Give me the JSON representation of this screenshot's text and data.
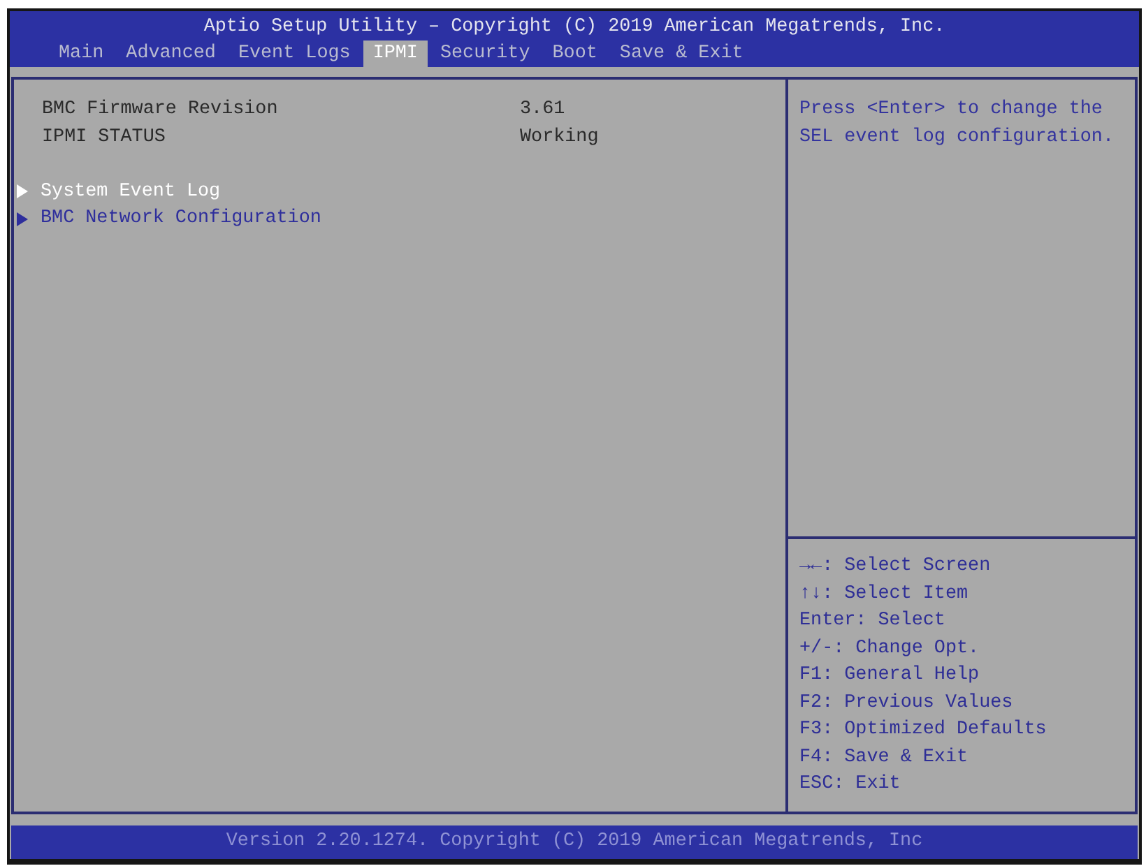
{
  "window": {
    "title": "Aptio Setup Utility – Copyright (C) 2019 American Megatrends, Inc."
  },
  "tabs": [
    {
      "label": "Main",
      "selected": false
    },
    {
      "label": "Advanced",
      "selected": false
    },
    {
      "label": "Event Logs",
      "selected": false
    },
    {
      "label": "IPMI",
      "selected": true
    },
    {
      "label": "Security",
      "selected": false
    },
    {
      "label": "Boot",
      "selected": false
    },
    {
      "label": "Save & Exit",
      "selected": false
    }
  ],
  "info_rows": [
    {
      "label": "BMC Firmware Revision",
      "value": "3.61"
    },
    {
      "label": "IPMI STATUS",
      "value": "Working"
    }
  ],
  "submenus": [
    {
      "label": "System Event Log",
      "selected": true
    },
    {
      "label": "BMC Network Configuration",
      "selected": false
    }
  ],
  "help": {
    "text": "Press <Enter> to change the SEL event log configuration."
  },
  "key_hints": [
    "→←: Select Screen",
    "↑↓: Select Item",
    "Enter: Select",
    "+/-: Change Opt.",
    "F1: General Help",
    "F2: Previous Values",
    "F3: Optimized Defaults",
    "F4: Save & Exit",
    "ESC: Exit"
  ],
  "status_bar": {
    "text": "Version 2.20.1274. Copyright (C) 2019 American Megatrends, Inc"
  }
}
